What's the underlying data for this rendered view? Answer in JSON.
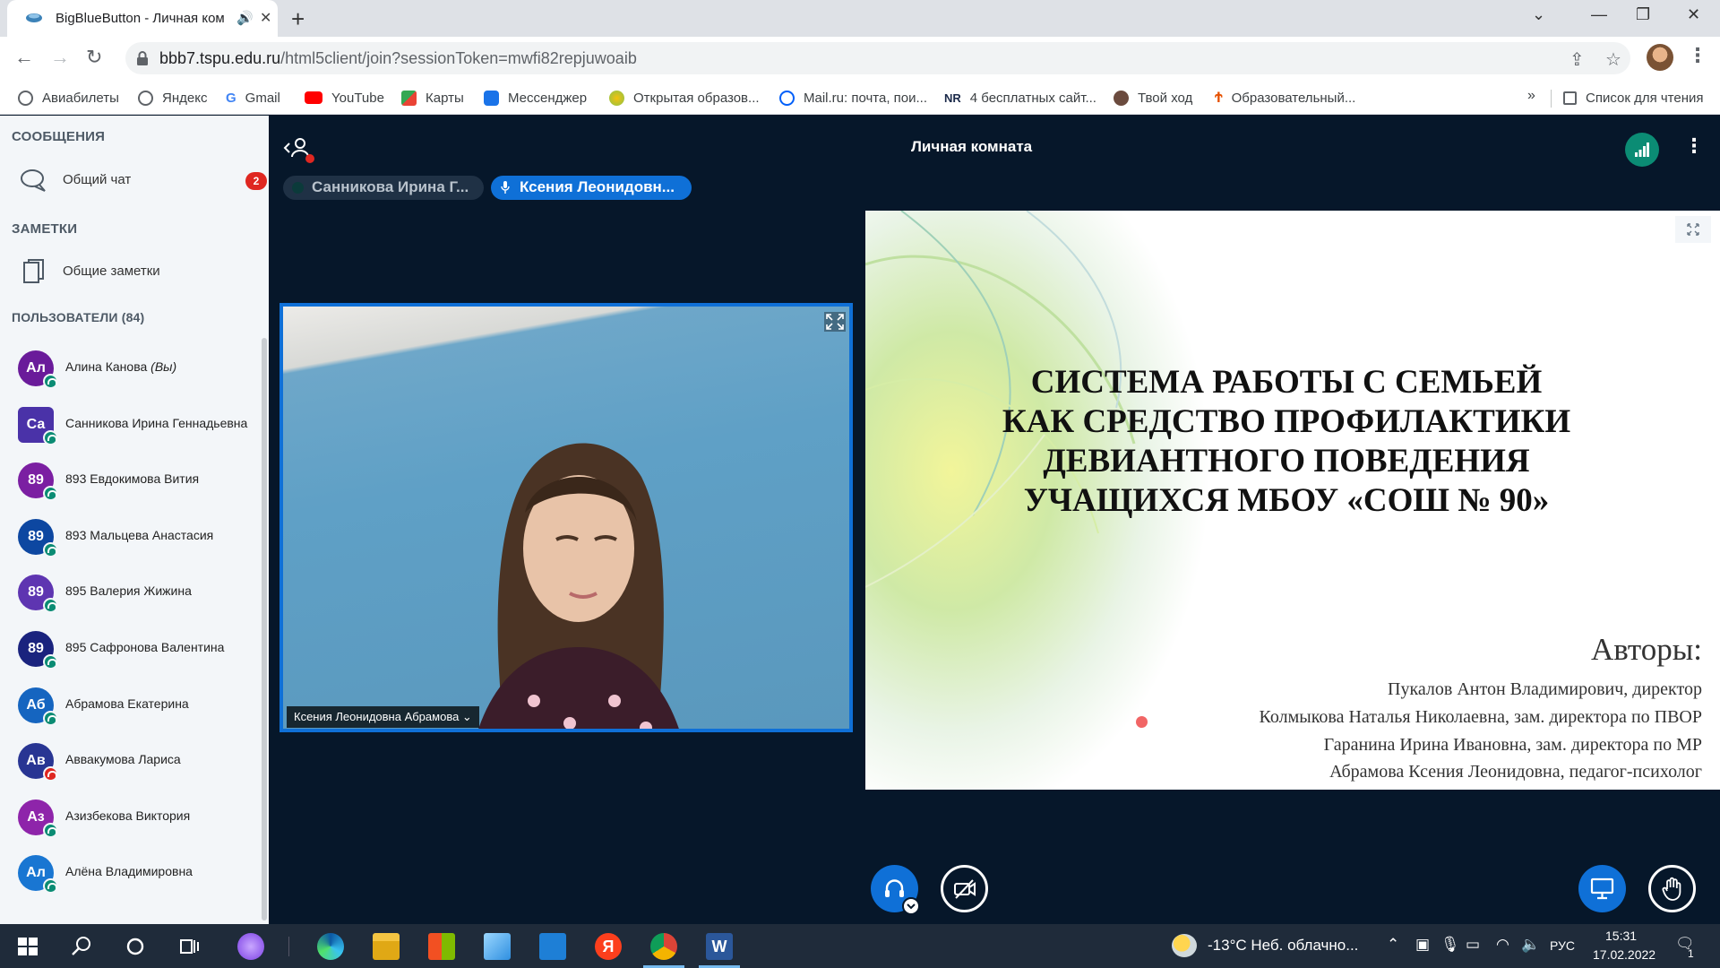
{
  "browser": {
    "tab_title": "BigBlueButton - Личная ком",
    "url_host": "bbb7.tspu.edu.ru",
    "url_path": "/html5client/join?sessionToken=mwfi82repjuwoaib",
    "bookmarks": [
      {
        "label": "Авиабилеты",
        "icon": "globe-icon",
        "color": "#5f6368"
      },
      {
        "label": "Яндекс",
        "icon": "globe-icon",
        "color": "#5f6368"
      },
      {
        "label": "Gmail",
        "icon": "google-icon",
        "color": "#4285f4"
      },
      {
        "label": "YouTube",
        "icon": "youtube-icon",
        "color": "#ff0000"
      },
      {
        "label": "Карты",
        "icon": "maps-icon",
        "color": "#34a853"
      },
      {
        "label": "Мессенджер",
        "icon": "messenger-icon",
        "color": "#1a73e8"
      },
      {
        "label": "Открытая образов...",
        "icon": "education-icon",
        "color": "#8bc34a"
      },
      {
        "label": "Mail.ru: почта, пои...",
        "icon": "mailru-icon",
        "color": "#005ff9"
      },
      {
        "label": "4 бесплатных сайт...",
        "icon": "nr-icon",
        "color": "#1b2a4a"
      },
      {
        "label": "Твой ход",
        "icon": "tvoyhod-icon",
        "color": "#6b4b3e"
      },
      {
        "label": "Образовательный...",
        "icon": "edu2-icon",
        "color": "#e65100"
      }
    ],
    "more_label": "»",
    "reading_list": "Список для чтения"
  },
  "sidebar": {
    "messages_title": "СООБЩЕНИЯ",
    "public_chat": "Общий чат",
    "chat_badge": "2",
    "notes_title": "ЗАМЕТКИ",
    "shared_notes": "Общие заметки",
    "users_title": "ПОЛЬЗОВАТЕЛИ (84)",
    "users": [
      {
        "initials": "Ал",
        "name": "Алина Канова",
        "suffix": "(Вы)",
        "color": "#6a1b9a",
        "status": "listen",
        "shape": "round"
      },
      {
        "initials": "Са",
        "name": "Санникова Ирина Геннадьевна",
        "suffix": "",
        "color": "#4a32a8",
        "status": "mic",
        "shape": "square"
      },
      {
        "initials": "89",
        "name": "893 Евдокимова Вития",
        "suffix": "",
        "color": "#7b1fa2",
        "status": "listen",
        "shape": "round"
      },
      {
        "initials": "89",
        "name": "893 Мальцева Анастасия",
        "suffix": "",
        "color": "#0d47a1",
        "status": "listen",
        "shape": "round"
      },
      {
        "initials": "89",
        "name": "895 Валерия Жижина",
        "suffix": "",
        "color": "#5e35b1",
        "status": "listen",
        "shape": "round"
      },
      {
        "initials": "89",
        "name": "895 Сафронова Валентина",
        "suffix": "",
        "color": "#1a237e",
        "status": "listen",
        "shape": "round"
      },
      {
        "initials": "Аб",
        "name": "Абрамова Екатерина",
        "suffix": "",
        "color": "#1565c0",
        "status": "listen",
        "shape": "round"
      },
      {
        "initials": "Ав",
        "name": "Аввакумова Лариса",
        "suffix": "",
        "color": "#283593",
        "status": "muted",
        "shape": "round"
      },
      {
        "initials": "Аз",
        "name": "Азизбекова Виктория",
        "suffix": "",
        "color": "#8e24aa",
        "status": "listen",
        "shape": "round"
      },
      {
        "initials": "Ал",
        "name": "Алёна Владимировна",
        "suffix": "",
        "color": "#1976d2",
        "status": "listen",
        "shape": "round"
      }
    ]
  },
  "meeting": {
    "room_title": "Личная комната",
    "talking": [
      "Санникова Ирина Г...",
      "Ксения Леонидовн..."
    ],
    "video_name": "Ксения Леонидовна Абрамова ⌄",
    "slide": {
      "title_lines": [
        "СИСТЕМА РАБОТЫ С СЕМЬЕЙ",
        "КАК СРЕДСТВО ПРОФИЛАКТИКИ",
        "ДЕВИАНТНОГО ПОВЕДЕНИЯ",
        "УЧАЩИХСЯ МБОУ «СОШ № 90»"
      ],
      "authors_heading": "Авторы:",
      "authors": [
        "Пукалов Антон Владимирович, директор",
        "Колмыкова Наталья Николаевна, зам. директора по ПВОР",
        "Гаранина Ирина Ивановна, зам. директора по МР",
        "Абрамова Ксения Леонидовна, педагог-психолог"
      ]
    }
  },
  "taskbar": {
    "weather": "-13°C  Неб. облачно...",
    "lang": "РУС",
    "time": "15:31",
    "date": "17.02.2022",
    "notifications": "1"
  },
  "colors": {
    "bbb_blue": "#0f70d7",
    "bbb_dark": "#06172a",
    "bbb_green": "#0b8c74",
    "badge_red": "#df2721"
  }
}
